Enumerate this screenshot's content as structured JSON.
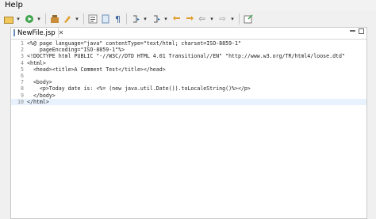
{
  "menu": {
    "help": "Help"
  },
  "toolbar": {
    "icons": [
      "open-icon",
      "run-icon",
      "build-icon",
      "toggle-icon",
      "format-icon",
      "pilcrow-icon",
      "annotation-icon",
      "search-icon",
      "back-icon",
      "forward-icon",
      "pin-icon"
    ]
  },
  "editor": {
    "tab_title": "NewFile.jsp",
    "tab_close": "✕",
    "lines": [
      {
        "num": "1",
        "text": "<%@ page language=\"java\" contentType=\"text/html; charset=ISO-8859-1\""
      },
      {
        "num": "2",
        "text": "    pageEncoding=\"ISO-8859-1\"%>"
      },
      {
        "num": "3",
        "text": "<!DOCTYPE html PUBLIC \"-//W3C//DTD HTML 4.01 Transitional//EN\" \"http://www.w3.org/TR/html4/loose.dtd\""
      },
      {
        "num": "4",
        "text": "<html>"
      },
      {
        "num": "5",
        "text": "  <head><title>A Comment Test</title></head>"
      },
      {
        "num": "6",
        "text": ""
      },
      {
        "num": "7",
        "text": "  <body>"
      },
      {
        "num": "8",
        "text": "    <p>Today date is: <%= (new java.util.Date()).toLocaleString()%></p>"
      },
      {
        "num": "9",
        "text": "  </body>"
      },
      {
        "num": "10",
        "text": "</html>"
      }
    ]
  }
}
